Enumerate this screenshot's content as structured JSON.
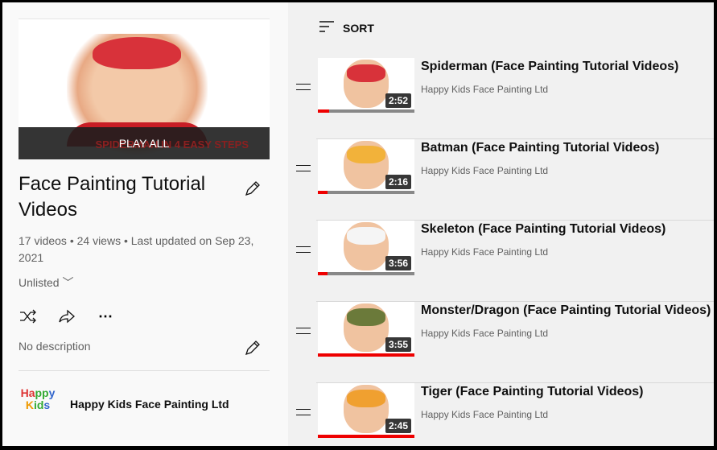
{
  "playlist": {
    "play_all": "PLAY ALL",
    "thumb_caption": "SPIDERMAN IN 4 EASY STEPS",
    "title": "Face Painting Tutorial Videos",
    "meta": "17 videos • 24 views • Last updated on Sep 23, 2021",
    "privacy": "Unlisted",
    "description": "No description",
    "owner": "Happy Kids Face Painting Ltd",
    "logo_text": "Happy Kids"
  },
  "sort_label": "SORT",
  "videos": [
    {
      "title": "Spiderman (Face Painting Tutorial Videos)",
      "channel": "Happy Kids Face Painting Ltd",
      "duration": "2:52",
      "progress": 0.12,
      "color": "#d8323a"
    },
    {
      "title": "Batman (Face Painting Tutorial Videos)",
      "channel": "Happy Kids Face Painting Ltd",
      "duration": "2:16",
      "progress": 0.1,
      "color": "#f2b23a"
    },
    {
      "title": "Skeleton (Face Painting Tutorial Videos)",
      "channel": "Happy Kids Face Painting Ltd",
      "duration": "3:56",
      "progress": 0.1,
      "color": "#f5f5f5"
    },
    {
      "title": "Monster/Dragon (Face Painting Tutorial Videos)",
      "channel": "Happy Kids Face Painting Ltd",
      "duration": "3:55",
      "progress": 1.0,
      "color": "#6b7a3a"
    },
    {
      "title": "Tiger (Face Painting Tutorial Videos)",
      "channel": "Happy Kids Face Painting Ltd",
      "duration": "2:45",
      "progress": 1.0,
      "color": "#f0a030"
    }
  ]
}
